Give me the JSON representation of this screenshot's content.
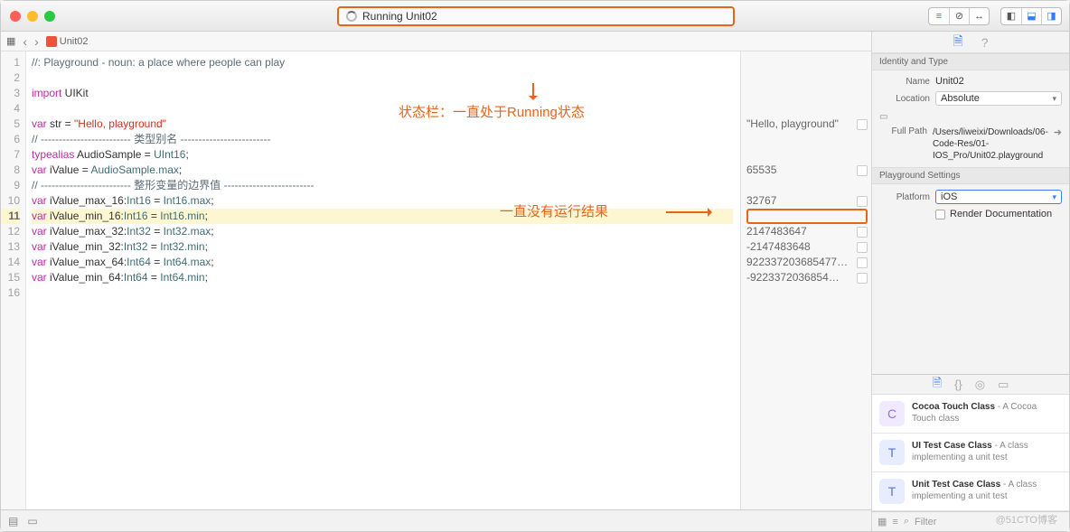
{
  "titlebar": {
    "status": "Running Unit02"
  },
  "jumpbar": {
    "crumb": "Unit02"
  },
  "annotations": {
    "top": "状态栏：一直处于Running状态",
    "mid": "一直没有运行结果"
  },
  "code": {
    "lines": [
      {
        "n": 1,
        "t": "comment",
        "text": "//: Playground - noun: a place where people can play"
      },
      {
        "n": 2,
        "t": "blank",
        "text": ""
      },
      {
        "n": 3,
        "t": "import",
        "kw": "import",
        "mod": "UIKit"
      },
      {
        "n": 4,
        "t": "blank",
        "text": ""
      },
      {
        "n": 5,
        "t": "decl",
        "kw": "var",
        "name": "str",
        "eq": " = ",
        "str": "\"Hello, playground\""
      },
      {
        "n": 6,
        "t": "comment",
        "text": "// ------------------------- 类型别名 -------------------------"
      },
      {
        "n": 7,
        "t": "alias",
        "kw": "typealias",
        "name": "AudioSample",
        "eq": " = ",
        "type": "UInt16",
        "tail": ";"
      },
      {
        "n": 8,
        "t": "decl2",
        "kw": "var",
        "name": "iValue",
        "eq": " = ",
        "type": "AudioSample",
        "prop": ".max",
        "tail": ";"
      },
      {
        "n": 9,
        "t": "comment",
        "text": "// ------------------------- 整形变量的边界值 -------------------------"
      },
      {
        "n": 10,
        "t": "typed",
        "kw": "var",
        "name": "iValue_max_16",
        "col": ":",
        "type": "Int16",
        "eq": " = ",
        "type2": "Int16",
        "prop": ".max",
        "tail": ";"
      },
      {
        "n": 11,
        "t": "typed",
        "kw": "var",
        "name": "iValue_min_16",
        "col": ":",
        "type": "Int16",
        "eq": " = ",
        "type2": "Int16",
        "prop": ".min",
        "tail": ";",
        "current": true
      },
      {
        "n": 12,
        "t": "typed",
        "kw": "var",
        "name": "iValue_max_32",
        "col": ":",
        "type": "Int32",
        "eq": " = ",
        "type2": "Int32",
        "prop": ".max",
        "tail": ";"
      },
      {
        "n": 13,
        "t": "typed",
        "kw": "var",
        "name": "iValue_min_32",
        "col": ":",
        "type": "Int32",
        "eq": " = ",
        "type2": "Int32",
        "prop": ".min",
        "tail": ";"
      },
      {
        "n": 14,
        "t": "typed",
        "kw": "var",
        "name": "iValue_max_64",
        "col": ":",
        "type": "Int64",
        "eq": " = ",
        "type2": "Int64",
        "prop": ".max",
        "tail": ";"
      },
      {
        "n": 15,
        "t": "typed",
        "kw": "var",
        "name": "iValue_min_64",
        "col": ":",
        "type": "Int64",
        "eq": " = ",
        "type2": "Int64",
        "prop": ".min",
        "tail": ";"
      },
      {
        "n": 16,
        "t": "blank",
        "text": ""
      }
    ]
  },
  "results": [
    {
      "row": 5,
      "text": "\"Hello, playground\""
    },
    {
      "row": 8,
      "text": "65535"
    },
    {
      "row": 10,
      "text": "32767"
    },
    {
      "row": 11,
      "text": "",
      "highlight": true
    },
    {
      "row": 12,
      "text": "2147483647"
    },
    {
      "row": 13,
      "text": "-2147483648"
    },
    {
      "row": 14,
      "text": "922337203685477…"
    },
    {
      "row": 15,
      "text": "-9223372036854…"
    }
  ],
  "inspector": {
    "identity_hdr": "Identity and Type",
    "name_lbl": "Name",
    "name_val": "Unit02",
    "loc_lbl": "Location",
    "loc_val": "Absolute",
    "path_lbl": "Full Path",
    "path_val": "/Users/liweixi/Downloads/06-Code-Res/01-IOS_Pro/Unit02.playground",
    "pg_hdr": "Playground Settings",
    "plat_lbl": "Platform",
    "plat_val": "iOS",
    "render_lbl": "Render Documentation"
  },
  "library": {
    "items": [
      {
        "icon": "C",
        "iconClass": "c",
        "title": "Cocoa Touch Class",
        "desc": " - A Cocoa Touch class"
      },
      {
        "icon": "T",
        "iconClass": "",
        "title": "UI Test Case Class",
        "desc": " - A class implementing a unit test"
      },
      {
        "icon": "T",
        "iconClass": "",
        "title": "Unit Test Case Class",
        "desc": " - A class implementing a unit test"
      }
    ],
    "filter_placeholder": "Filter"
  },
  "watermark": "@51CTO博客"
}
